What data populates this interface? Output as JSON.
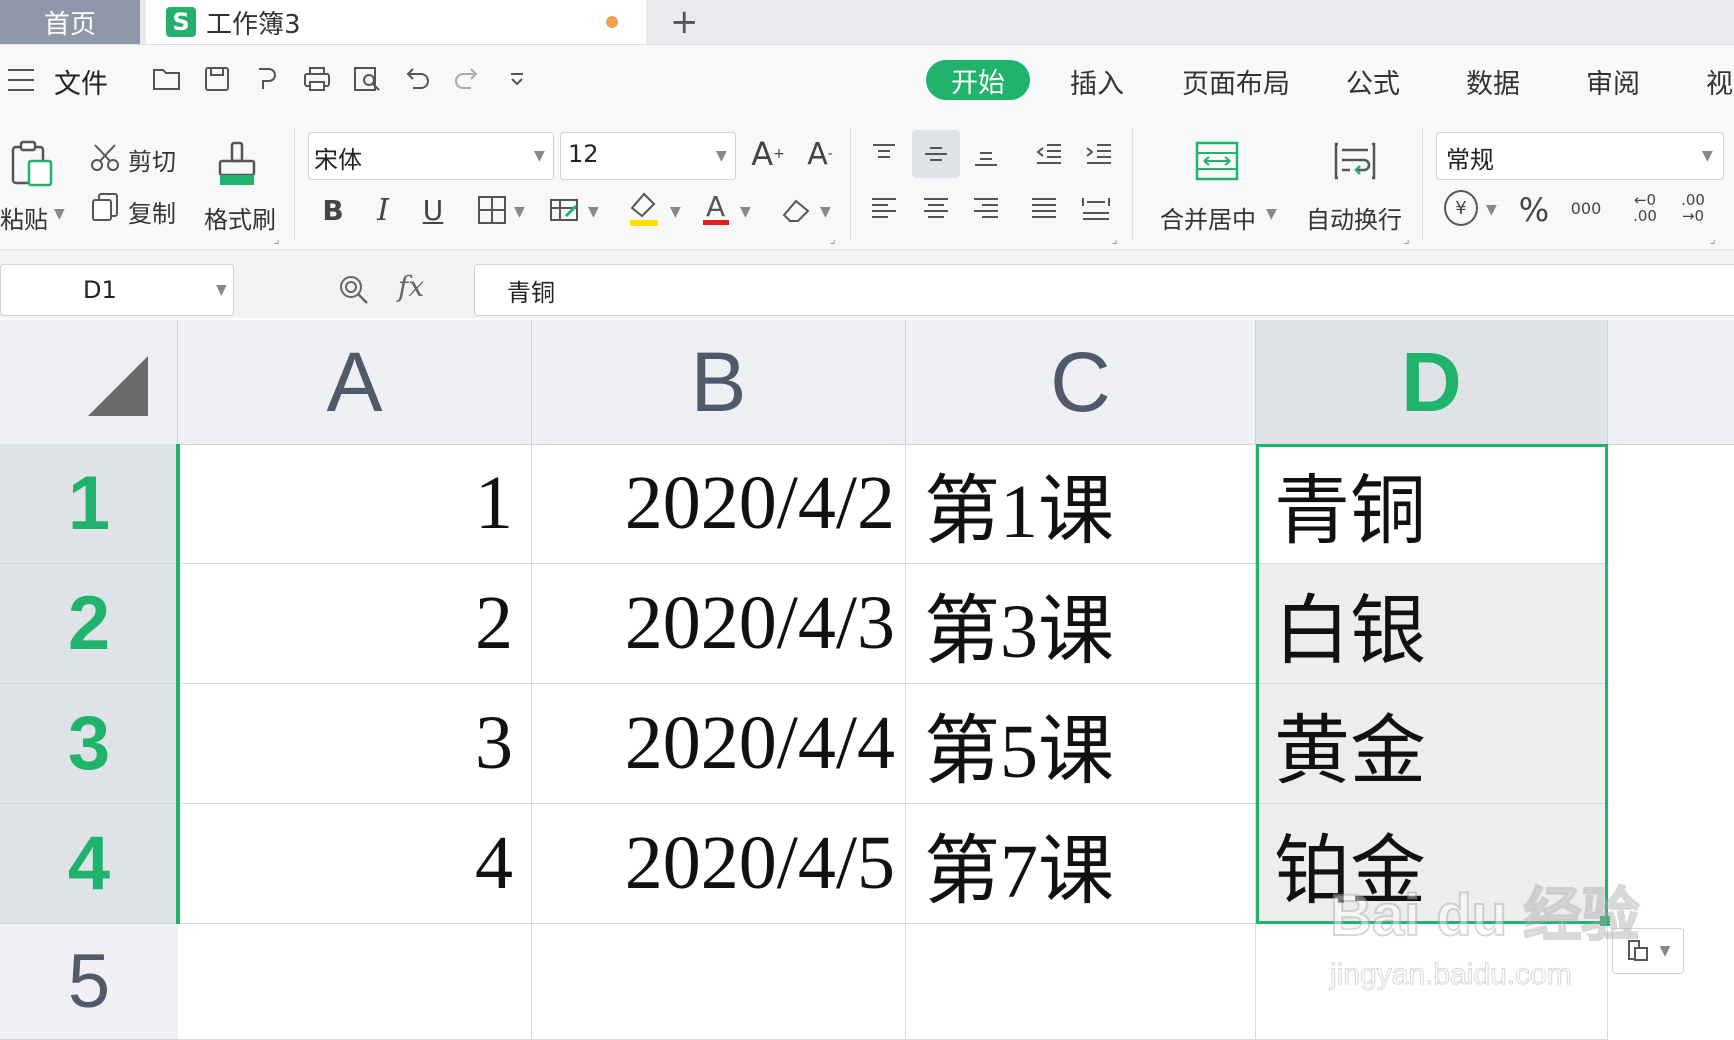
{
  "tabs": {
    "home": "首页",
    "workbook": "工作簿3",
    "add": "+"
  },
  "menu": {
    "file": "文件",
    "tabs": [
      "开始",
      "插入",
      "页面布局",
      "公式",
      "数据",
      "审阅",
      "视"
    ]
  },
  "ribbon": {
    "paste": "粘贴",
    "cut": "剪切",
    "copy": "复制",
    "format_painter": "格式刷",
    "font_name": "宋体",
    "font_size": "12",
    "bold": "B",
    "italic": "I",
    "underline": "U",
    "merge_center": "合并居中",
    "wrap_text": "自动换行",
    "number_format": "常规",
    "currency": "¥",
    "percent": "%",
    "thousands": "000",
    "inc_decimal": "←0 .00",
    "dec_decimal": ".00 →0"
  },
  "formula_bar": {
    "cell_ref": "D1",
    "fx": "fx",
    "content": "青铜"
  },
  "grid": {
    "columns": [
      "A",
      "B",
      "C",
      "D"
    ],
    "rows": [
      {
        "num": "1",
        "a": "1",
        "b": "2020/4/2",
        "c": "第1课",
        "d": "青铜"
      },
      {
        "num": "2",
        "a": "2",
        "b": "2020/4/3",
        "c": "第3课",
        "d": "白银"
      },
      {
        "num": "3",
        "a": "3",
        "b": "2020/4/4",
        "c": "第5课",
        "d": "黄金"
      },
      {
        "num": "4",
        "a": "4",
        "b": "2020/4/5",
        "c": "第7课",
        "d": "铂金"
      },
      {
        "num": "5",
        "a": "",
        "b": "",
        "c": "",
        "d": ""
      }
    ]
  },
  "watermark": {
    "brand": "Bai du 经验",
    "url": "jingyan.baidu.com"
  },
  "colors": {
    "accent": "#1fb36b",
    "header_bg": "#eef0f3",
    "font_red": "#e02020",
    "highlight_yellow": "#ffe000"
  }
}
